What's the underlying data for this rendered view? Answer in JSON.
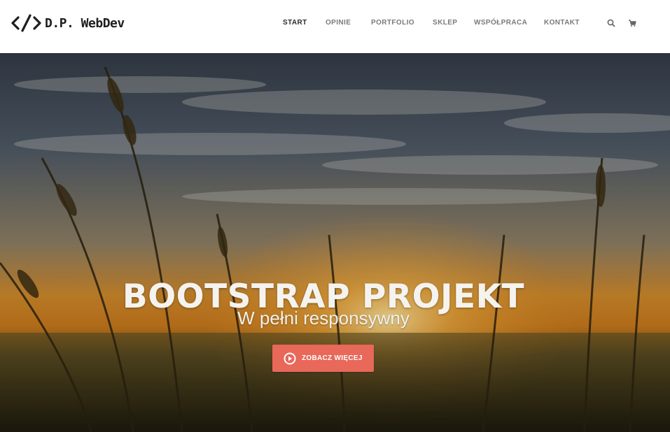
{
  "brand": {
    "name": "D.P. WebDev",
    "icon": "code-brackets-icon"
  },
  "nav": {
    "items": [
      {
        "label": "START",
        "active": true
      },
      {
        "label": "OPINIE",
        "active": false
      },
      {
        "label": "PORTFOLIO",
        "active": false
      },
      {
        "label": "SKLEP",
        "active": false
      },
      {
        "label": "WSPÓŁPRACA",
        "active": false
      },
      {
        "label": "KONTAKT",
        "active": false
      }
    ],
    "icons": [
      "search-icon",
      "cart-icon"
    ]
  },
  "hero": {
    "title": "BOOTSTRAP PROJEKT",
    "subtitle": "W pełni responsywny",
    "cta_label": "ZOBACZ WIĘCEJ",
    "cta_icon": "play-circle-icon",
    "background": "sunset-wheat-field"
  },
  "colors": {
    "accent": "#e8685a",
    "nav_text": "#7a7a7a",
    "nav_active": "#2b2b2b",
    "hero_text": "#f5f3ef"
  }
}
